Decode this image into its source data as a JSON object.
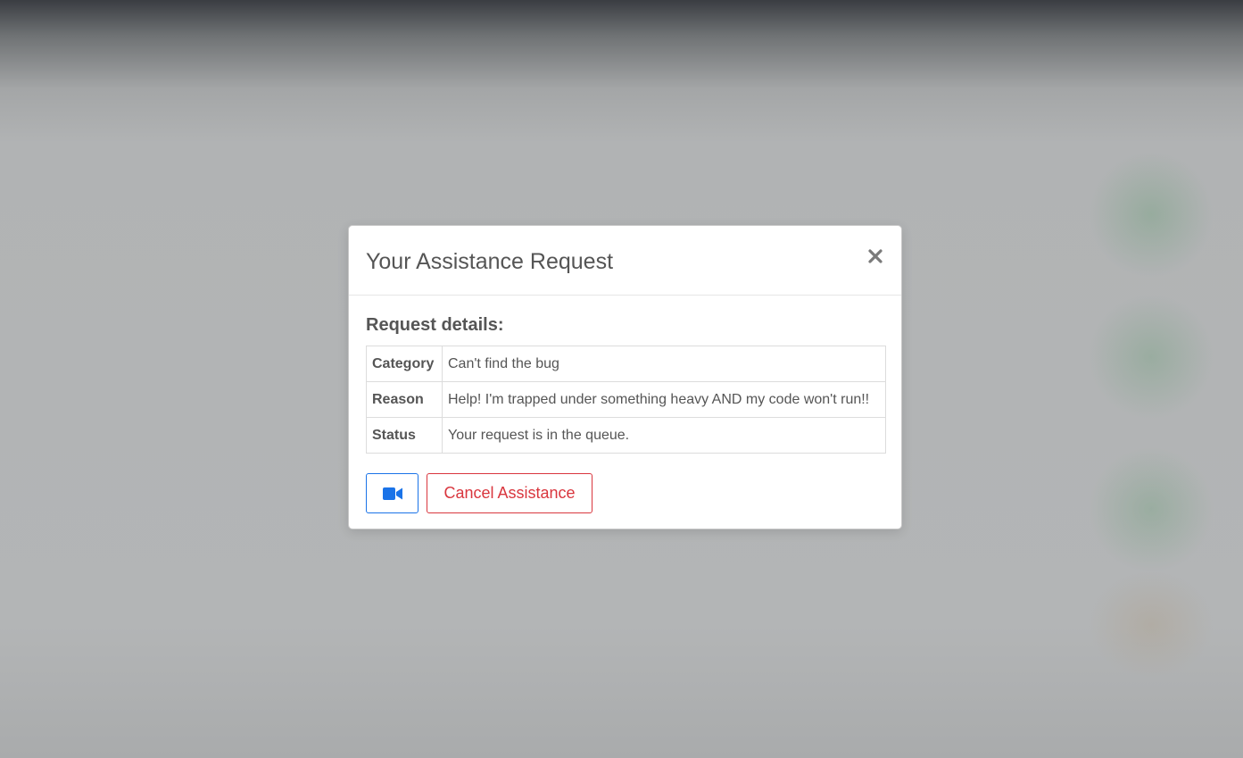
{
  "modal": {
    "title": "Your Assistance Request",
    "close_label": "×",
    "section_title": "Request details:",
    "details": [
      {
        "label": "Category",
        "value": "Can't find the bug"
      },
      {
        "label": "Reason",
        "value": "Help! I'm trapped under something heavy AND my code won't run!!"
      },
      {
        "label": "Status",
        "value": "Your request is in the queue."
      }
    ],
    "video_button": {
      "icon": "video-camera-icon",
      "color": "#1a73e8"
    },
    "cancel_button": {
      "label": "Cancel Assistance",
      "color": "#d9363e"
    }
  }
}
